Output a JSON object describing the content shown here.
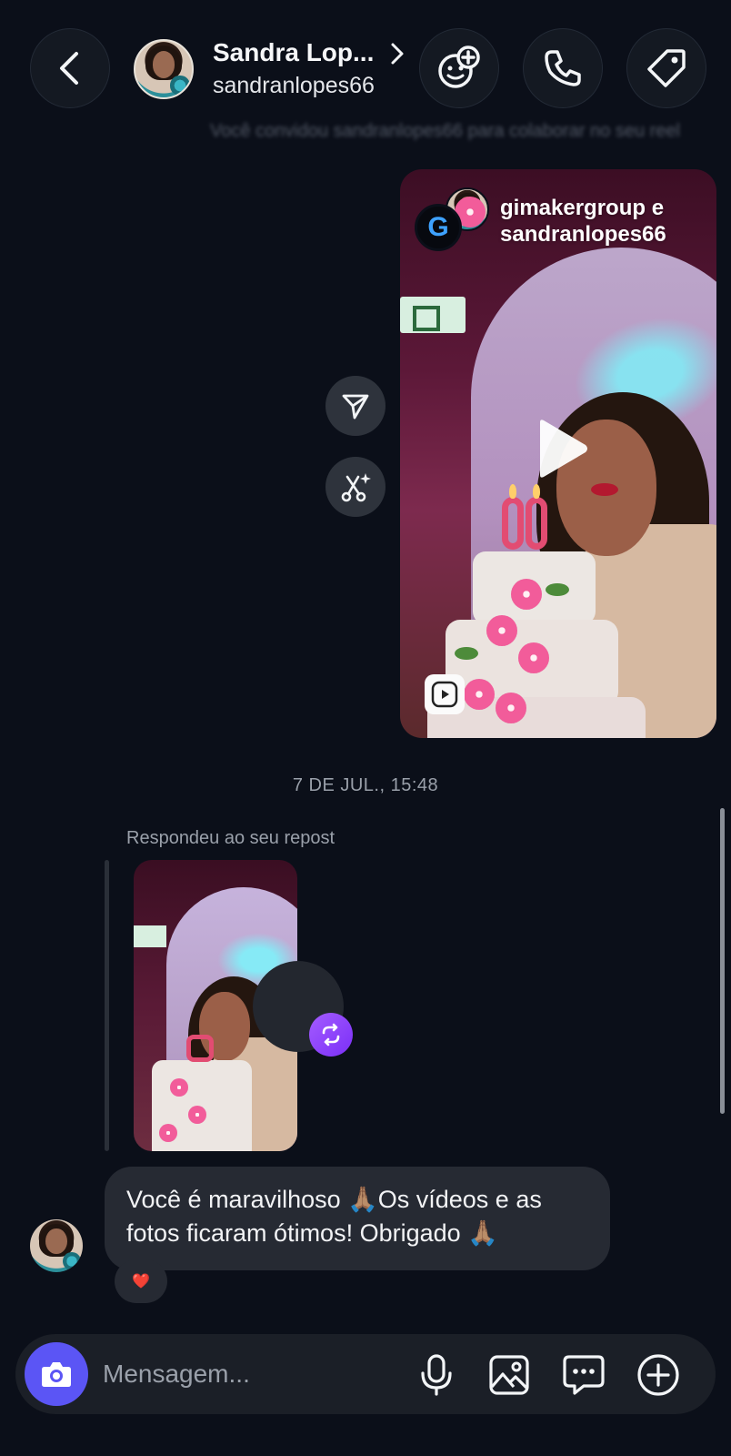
{
  "header": {
    "name": "Sandra Lop...",
    "username": "sandranlopes66",
    "icons": [
      "chevron-left-icon",
      "chevron-right-icon",
      "effects-add-icon",
      "phone-icon",
      "tag-icon"
    ]
  },
  "system_note": "Você convidou sandranlopes66 para colaborar no seu reel",
  "reel": {
    "title": "gimakergroup e sandranlopes66",
    "logo_letter": "G",
    "candle_number": "60"
  },
  "timestamp": "7 DE JUL., 15:48",
  "reply": {
    "label": "Respondeu ao seu repost"
  },
  "message": {
    "text": "Você é maravilhoso 🙏🏽Os vídeos e as fotos ficaram ótimos! Obrigado 🙏🏽",
    "reaction": "❤️"
  },
  "composer": {
    "placeholder": "Mensagem..."
  },
  "colors": {
    "background": "#0b0f19",
    "camera_button": "#5b55f5",
    "repost_badge": "#8a3cfa",
    "bubble": "#262a33"
  }
}
